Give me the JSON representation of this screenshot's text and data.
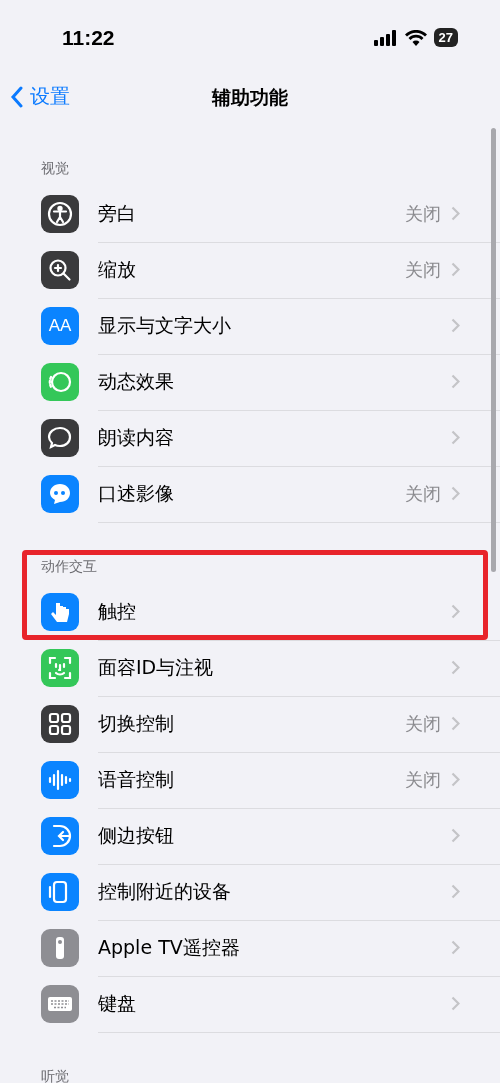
{
  "status_bar": {
    "time": "11:22",
    "battery": "27"
  },
  "nav": {
    "back": "设置",
    "title": "辅助功能"
  },
  "sections": [
    {
      "header": "视觉",
      "items": [
        {
          "label": "旁白",
          "value": "关闭",
          "kind": "person",
          "color": "#3a3a3c",
          "highlighted": false
        },
        {
          "label": "缩放",
          "value": "关闭",
          "kind": "zoom",
          "color": "#3a3a3c",
          "highlighted": false
        },
        {
          "label": "显示与文字大小",
          "kind": "text",
          "icon_text": "AA",
          "color": "#0a84ff",
          "highlighted": false
        },
        {
          "label": "动态效果",
          "kind": "motion",
          "color": "#34c759",
          "highlighted": false
        },
        {
          "label": "朗读内容",
          "kind": "speech",
          "color": "#3a3a3c",
          "highlighted": false
        },
        {
          "label": "口述影像",
          "value": "关闭",
          "kind": "chat",
          "color": "#0a84ff",
          "highlighted": false
        }
      ]
    },
    {
      "header": "动作交互",
      "items": [
        {
          "label": "触控",
          "kind": "hand",
          "color": "#0a84ff",
          "highlighted": true
        },
        {
          "label": "面容ID与注视",
          "kind": "face",
          "color": "#34c759",
          "highlighted": false
        },
        {
          "label": "切换控制",
          "value": "关闭",
          "kind": "grid",
          "color": "#3a3a3c",
          "highlighted": false
        },
        {
          "label": "语音控制",
          "value": "关闭",
          "kind": "wave",
          "color": "#0a84ff",
          "highlighted": false
        },
        {
          "label": "侧边按钮",
          "kind": "side",
          "color": "#0a84ff",
          "highlighted": false
        },
        {
          "label": "控制附近的设备",
          "kind": "phone",
          "color": "#0a84ff",
          "highlighted": false
        },
        {
          "label": "Apple TV遥控器",
          "kind": "remote",
          "color": "#8e8e93",
          "highlighted": false
        },
        {
          "label": "键盘",
          "kind": "keyboard",
          "color": "#8e8e93",
          "highlighted": false
        }
      ]
    },
    {
      "header": "听觉"
    }
  ]
}
